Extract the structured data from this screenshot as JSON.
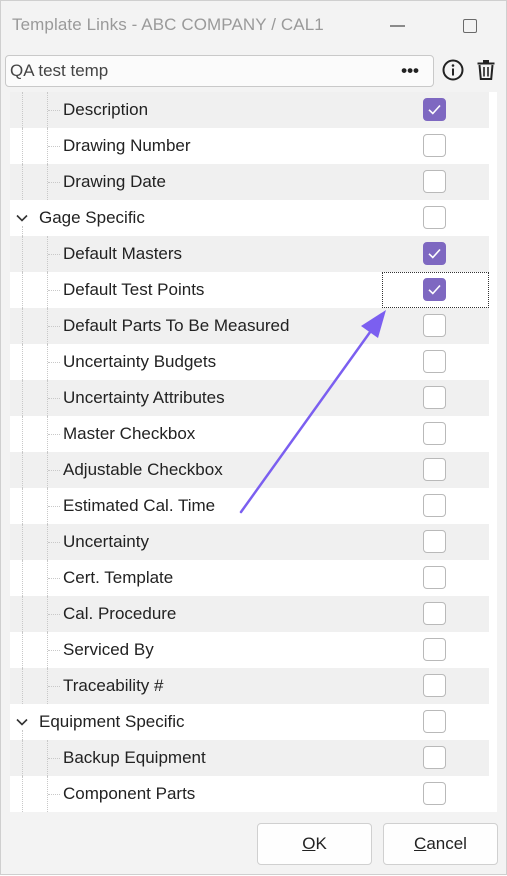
{
  "window": {
    "title": "Template Links - ABC COMPANY / CAL1"
  },
  "toolbar": {
    "template_value": "QA test temp",
    "ellipsis_label": "•••",
    "info_icon": "info-icon",
    "delete_icon": "trash-icon"
  },
  "tree": {
    "rows": [
      {
        "label": "Description",
        "level": 1,
        "checked": true,
        "expander": false
      },
      {
        "label": "Drawing Number",
        "level": 1,
        "checked": false,
        "expander": false
      },
      {
        "label": "Drawing Date",
        "level": 1,
        "checked": false,
        "expander": false
      },
      {
        "label": "Gage Specific",
        "level": 0,
        "checked": false,
        "expander": true
      },
      {
        "label": "Default Masters",
        "level": 1,
        "checked": true,
        "expander": false
      },
      {
        "label": "Default Test Points",
        "level": 1,
        "checked": true,
        "expander": false,
        "focused": true
      },
      {
        "label": "Default Parts To Be Measured",
        "level": 1,
        "checked": false,
        "expander": false
      },
      {
        "label": "Uncertainty Budgets",
        "level": 1,
        "checked": false,
        "expander": false
      },
      {
        "label": "Uncertainty Attributes",
        "level": 1,
        "checked": false,
        "expander": false
      },
      {
        "label": "Master Checkbox",
        "level": 1,
        "checked": false,
        "expander": false
      },
      {
        "label": "Adjustable Checkbox",
        "level": 1,
        "checked": false,
        "expander": false
      },
      {
        "label": "Estimated Cal. Time",
        "level": 1,
        "checked": false,
        "expander": false
      },
      {
        "label": "Uncertainty",
        "level": 1,
        "checked": false,
        "expander": false
      },
      {
        "label": "Cert. Template",
        "level": 1,
        "checked": false,
        "expander": false
      },
      {
        "label": "Cal. Procedure",
        "level": 1,
        "checked": false,
        "expander": false
      },
      {
        "label": "Serviced By",
        "level": 1,
        "checked": false,
        "expander": false
      },
      {
        "label": "Traceability #",
        "level": 1,
        "checked": false,
        "expander": false
      },
      {
        "label": "Equipment Specific",
        "level": 0,
        "checked": false,
        "expander": true
      },
      {
        "label": "Backup Equipment",
        "level": 1,
        "checked": false,
        "expander": false
      },
      {
        "label": "Component Parts",
        "level": 1,
        "checked": false,
        "expander": false
      }
    ]
  },
  "footer": {
    "ok_label": "OK",
    "cancel_label": "Cancel"
  },
  "colors": {
    "accent": "#7e68c1",
    "annotation_arrow": "#7b5ff0"
  }
}
